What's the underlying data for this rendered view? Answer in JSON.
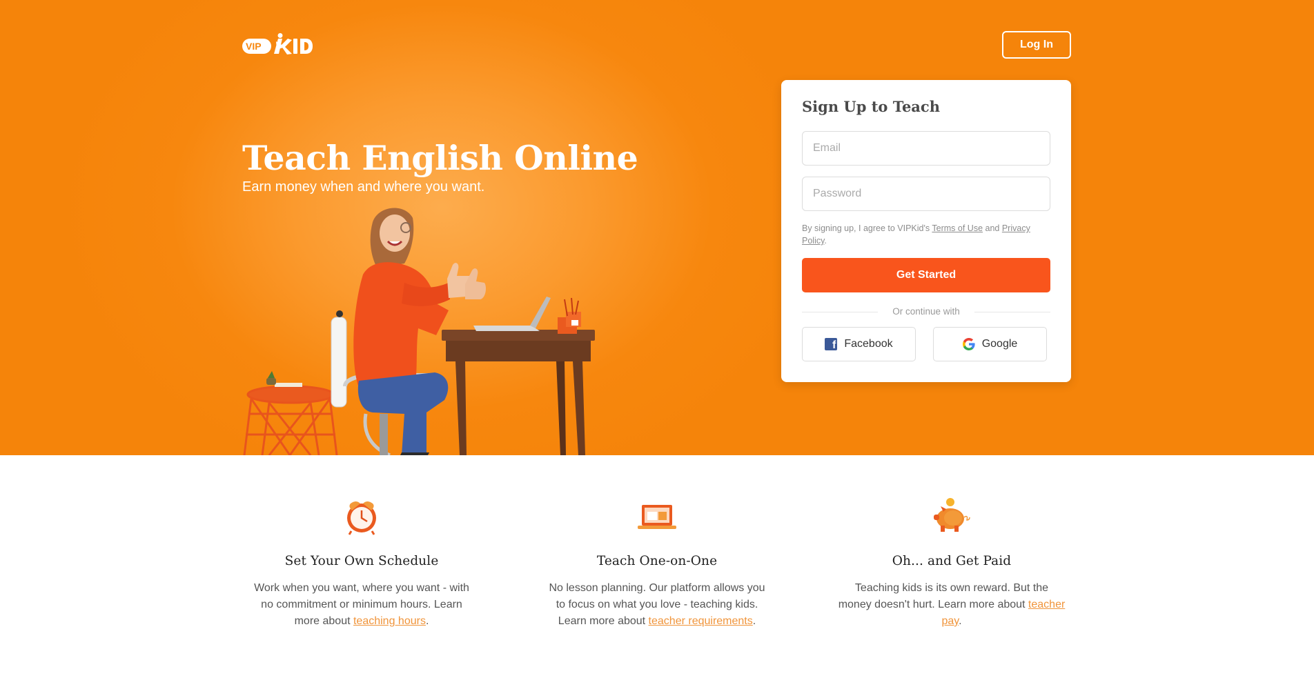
{
  "header": {
    "logo_alt": "VIPKID",
    "login_label": "Log In"
  },
  "hero": {
    "title": "Teach English Online",
    "subtitle": "Earn money when and where you want."
  },
  "signup": {
    "title": "Sign Up to Teach",
    "email_placeholder": "Email",
    "password_placeholder": "Password",
    "terms_prefix": "By signing up, I agree to VIPKid's ",
    "terms_link": "Terms of Use",
    "terms_and": " and ",
    "privacy_link": "Privacy Policy",
    "terms_suffix": ".",
    "cta_label": "Get Started",
    "divider_text": "Or continue with",
    "facebook_label": "Facebook",
    "google_label": "Google"
  },
  "features": [
    {
      "icon": "alarm-clock-icon",
      "title": "Set Your Own Schedule",
      "text_before": "Work when you want, where you want - with no commitment or minimum hours. Learn more about ",
      "link": "teaching hours",
      "text_after": "."
    },
    {
      "icon": "laptop-lesson-icon",
      "title": "Teach One-on-One",
      "text_before": "No lesson planning. Our platform allows you to focus on what you love - teaching kids. Learn more about ",
      "link": "teacher requirements",
      "text_after": "."
    },
    {
      "icon": "piggy-bank-icon",
      "title": "Oh... and Get Paid",
      "text_before": "Teaching kids is its own reward. But the money doesn't hurt. Learn more about ",
      "link": "teacher pay",
      "text_after": "."
    }
  ],
  "colors": {
    "hero_orange": "#f5840a",
    "cta_orange": "#f9551c",
    "link_orange": "#f0943a",
    "facebook_blue": "#3b5998"
  }
}
